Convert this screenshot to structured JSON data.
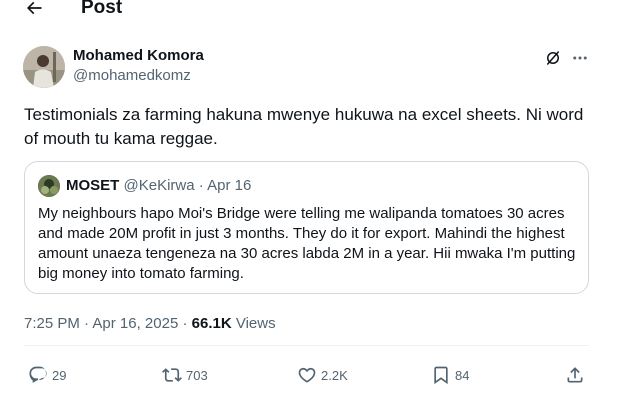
{
  "header": {
    "title": "Post",
    "back_icon": "arrow-left-icon"
  },
  "post": {
    "author": {
      "name": "Mohamed Komora",
      "handle": "@mohamedkomz"
    },
    "text": "Testimonials za farming hakuna mwenye hukuwa na excel sheets. Ni word of mouth tu kama reggae.",
    "time": "7:25 PM",
    "separator": " · ",
    "date": "Apr 16, 2025",
    "views_count": "66.1K",
    "views_label": "Views"
  },
  "quote": {
    "name": "MOSET",
    "handle": "@KeKirwa",
    "separator": " · ",
    "date": "Apr 16",
    "text": "My neighbours hapo Moi's Bridge  were telling me walipanda tomatoes 30 acres  and made 20M  profit in just 3 months. They do it for export. Mahindi the highest amount unaeza tengeneza na 30 acres labda 2M in a year. Hii mwaka I'm putting big money into tomato farming."
  },
  "actions": {
    "reply": {
      "icon": "reply-icon",
      "count": "29"
    },
    "repost": {
      "icon": "repost-icon",
      "count": "703"
    },
    "like": {
      "icon": "heart-icon",
      "count": "2.2K"
    },
    "bookmark": {
      "icon": "bookmark-icon",
      "count": "84"
    },
    "share": {
      "icon": "share-icon"
    }
  },
  "colors": {
    "text": "#0f1419",
    "secondary": "#536471",
    "border": "#cfd9de",
    "divider": "#eff3f4"
  }
}
